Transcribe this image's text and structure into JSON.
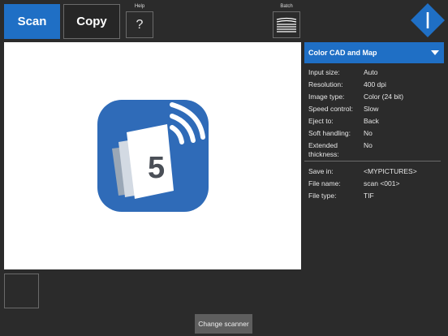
{
  "toolbar": {
    "scan_label": "Scan",
    "copy_label": "Copy",
    "help_label": "Help",
    "help_glyph": "?",
    "batch_label": "Batch"
  },
  "preview": {
    "icon": "scansnap-5-icon",
    "icon_number": "5"
  },
  "settings": {
    "profile": "Color CAD and Map",
    "rows": [
      {
        "label": "Input size:",
        "value": "Auto"
      },
      {
        "label": "Resolution:",
        "value": "400 dpi"
      },
      {
        "label": "Image type:",
        "value": "Color (24 bit)"
      },
      {
        "label": "Speed control:",
        "value": "Slow"
      },
      {
        "label": "Eject to:",
        "value": "Back"
      },
      {
        "label": "Soft handling:",
        "value": "No"
      },
      {
        "label": "Extended thickness:",
        "value": "No"
      }
    ],
    "file_rows": [
      {
        "label": "Save in:",
        "value": "<MYPICTURES>"
      },
      {
        "label": "File name:",
        "value": "scan <001>"
      },
      {
        "label": "File type:",
        "value": "TIF"
      }
    ]
  },
  "footer": {
    "change_scanner_label": "Change scanner"
  },
  "colors": {
    "accent": "#1f6fc5",
    "background": "#2b2b2b"
  }
}
